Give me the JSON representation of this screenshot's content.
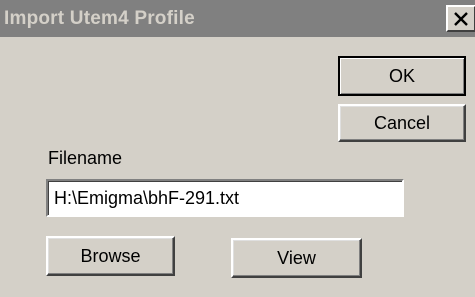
{
  "window": {
    "title": "Import Utem4 Profile",
    "close_glyph": "✕"
  },
  "buttons": {
    "ok": "OK",
    "cancel": "Cancel",
    "browse": "Browse",
    "view": "View"
  },
  "filename": {
    "label": "Filename",
    "value": "H:\\Emigma\\bhF-291.txt"
  },
  "colors": {
    "titlebar_inactive": "#808080",
    "face": "#d4d0c8"
  },
  "icons": {
    "close": "close-icon"
  }
}
